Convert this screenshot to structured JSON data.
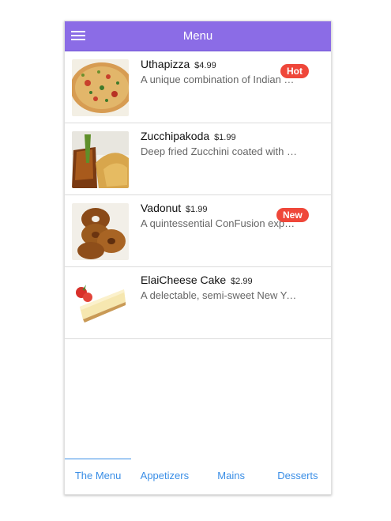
{
  "header": {
    "title": "Menu"
  },
  "dishes": [
    {
      "name": "Uthapizza",
      "price": "$4.99",
      "description": "A unique combination of Indian Uthappam (pancake) and Italian pizza",
      "badge": "Hot"
    },
    {
      "name": "Zucchipakoda",
      "price": "$1.99",
      "description": "Deep fried Zucchini coated with mildly spiced Chickpea flour batter",
      "badge": ""
    },
    {
      "name": "Vadonut",
      "price": "$1.99",
      "description": "A quintessential ConFusion experience, is it a vada or is it a donut?",
      "badge": "New"
    },
    {
      "name": "ElaiCheese Cake",
      "price": "$2.99",
      "description": "A delectable, semi-sweet New York Style Cheese Cake",
      "badge": ""
    }
  ],
  "tabs": [
    {
      "label": "The Menu",
      "active": true
    },
    {
      "label": "Appetizers",
      "active": false
    },
    {
      "label": "Mains",
      "active": false
    },
    {
      "label": "Desserts",
      "active": false
    }
  ],
  "colors": {
    "header": "#8b6ce6",
    "badge": "#ef473a",
    "tab_text": "#3a8ee6"
  }
}
